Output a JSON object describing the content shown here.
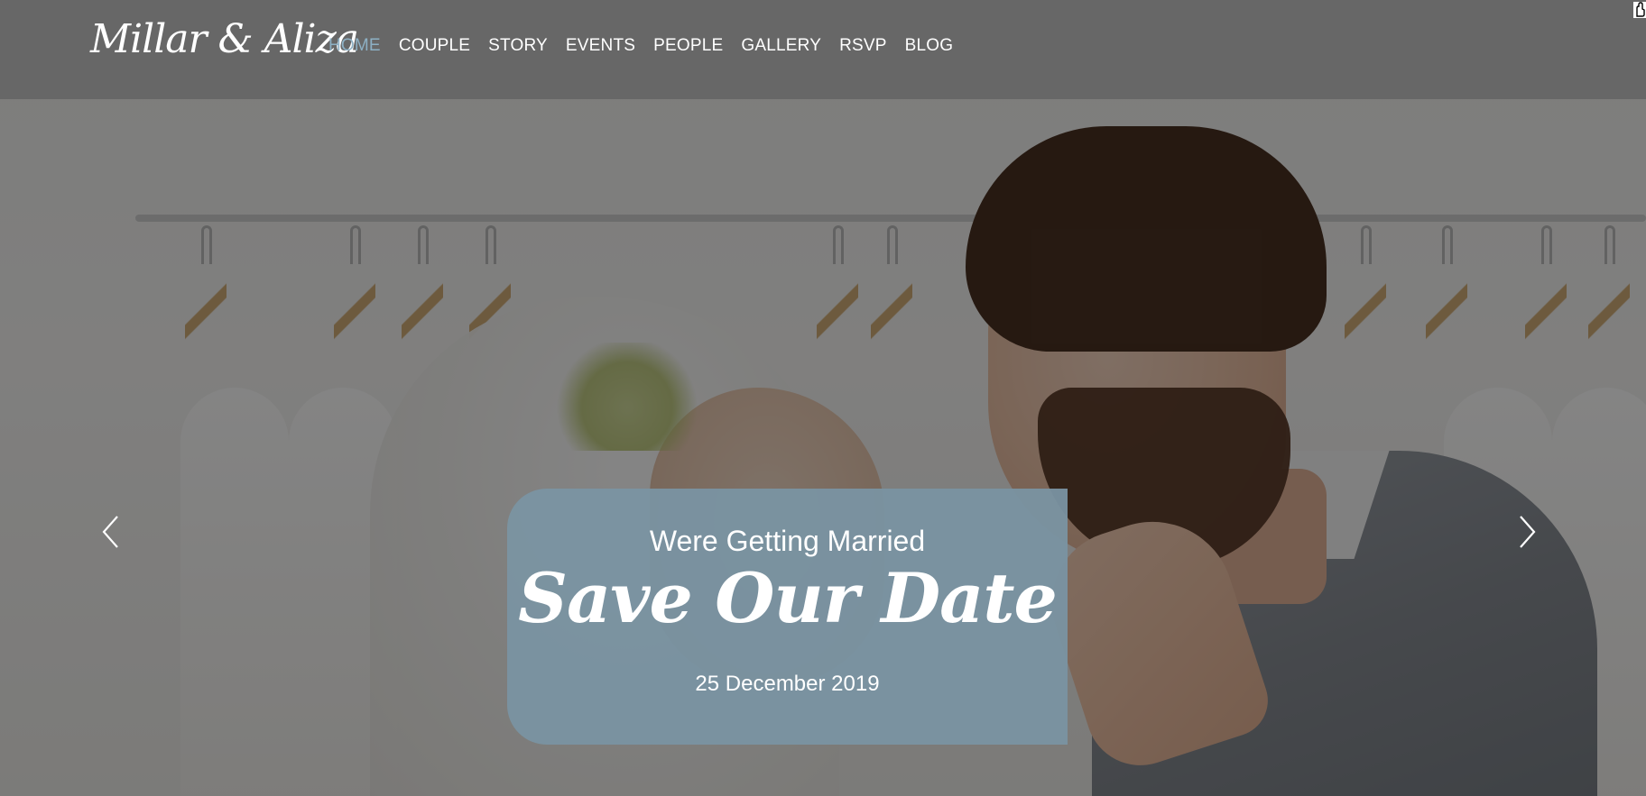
{
  "brand": {
    "logo_text": "Millar & Aliza"
  },
  "nav": {
    "items": [
      {
        "label": "HOME",
        "active": true
      },
      {
        "label": "COUPLE",
        "active": false
      },
      {
        "label": "STORY",
        "active": false
      },
      {
        "label": "EVENTS",
        "active": false
      },
      {
        "label": "PEOPLE",
        "active": false
      },
      {
        "label": "GALLERY",
        "active": false
      },
      {
        "label": "RSVP",
        "active": false
      },
      {
        "label": "BLOG",
        "active": false
      }
    ]
  },
  "hero": {
    "subtitle": "Were Getting Married",
    "headline": "Save Our Date",
    "date": "25 December 2019"
  },
  "carousel": {
    "prev_icon": "chevron-left-icon",
    "next_icon": "chevron-right-icon"
  },
  "colors": {
    "header_bg": "#666666",
    "nav_active": "#8db0c4",
    "nav_text": "#ffffff",
    "card_bg": "#7a94a2"
  }
}
